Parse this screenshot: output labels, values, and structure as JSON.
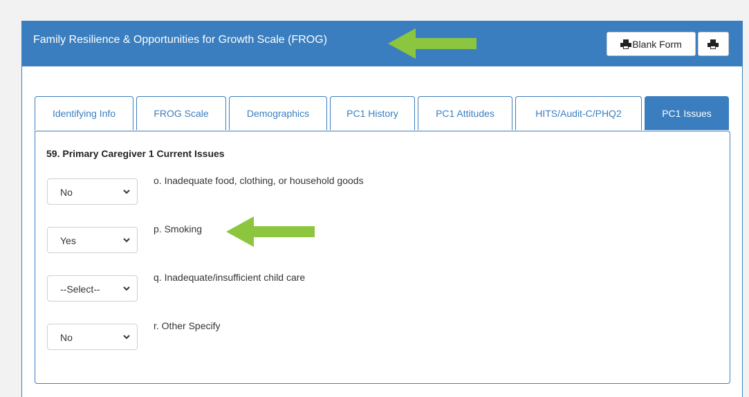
{
  "panel": {
    "title": "Family Resilience & Opportunities for Growth Scale (FROG)",
    "accent_color": "#3a7ebf",
    "arrow_color": "#8cc63f",
    "blank_form_label": "Blank Form",
    "print_icon": "printer-icon"
  },
  "tabs": [
    {
      "label": "Identifying Info",
      "active": false
    },
    {
      "label": "FROG Scale",
      "active": false
    },
    {
      "label": "Demographics",
      "active": false
    },
    {
      "label": "PC1 History",
      "active": false
    },
    {
      "label": "PC1 Attitudes",
      "active": false
    },
    {
      "label": "HITS/Audit-C/PHQ2",
      "active": false
    },
    {
      "label": "PC1 Issues",
      "active": true
    }
  ],
  "section": {
    "title": "59. Primary Caregiver 1 Current Issues"
  },
  "issues": [
    {
      "value": "No",
      "label": "o. Inadequate food, clothing, or household goods"
    },
    {
      "value": "Yes",
      "label": "p. Smoking"
    },
    {
      "value": "--Select--",
      "label": "q. Inadequate/insufficient child care"
    },
    {
      "value": "No",
      "label": "r. Other Specify"
    }
  ]
}
